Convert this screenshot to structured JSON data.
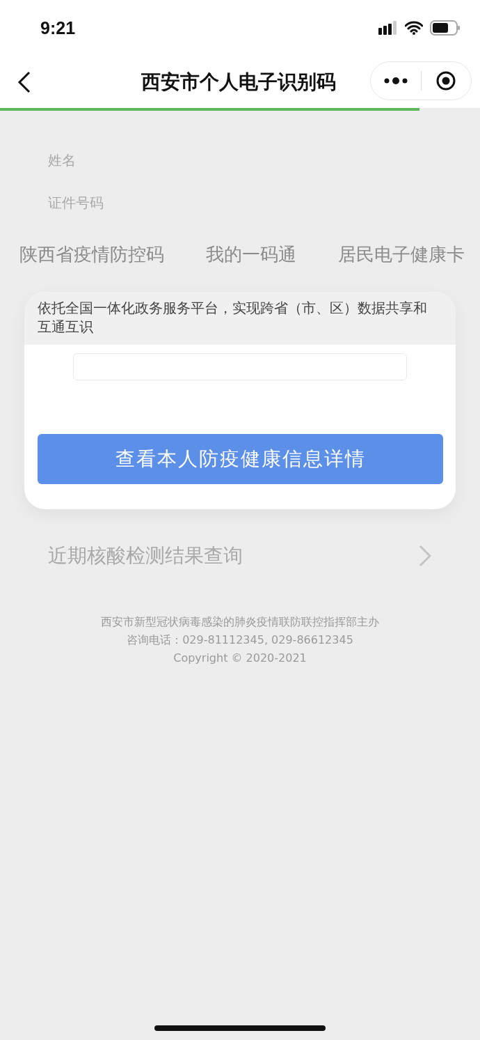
{
  "status_bar": {
    "time": "9:21"
  },
  "nav_bar": {
    "title": "西安市个人电子识别码",
    "progress": {
      "level": 0.874
    }
  },
  "profile": {
    "fields": [
      "姓名",
      "证件号码"
    ]
  },
  "tabs": [
    {
      "label": "陕西省疫情防控码"
    },
    {
      "label": "我的一码通"
    },
    {
      "label": "居民电子健康卡"
    }
  ],
  "card": {
    "notice": "依托全国一体化政务服务平台，实现跨省（市、区）数据共享和互通互识",
    "button": "查看本人防疫健康信息详情"
  },
  "link_row": {
    "label": "近期核酸检测结果查询"
  },
  "footer": [
    "西安市新型冠状病毒感染的肺炎疫情联防联控指挥部主办",
    "咨询电话：029-81112345, 029-86612345",
    "Copyright © 2020-2021"
  ]
}
